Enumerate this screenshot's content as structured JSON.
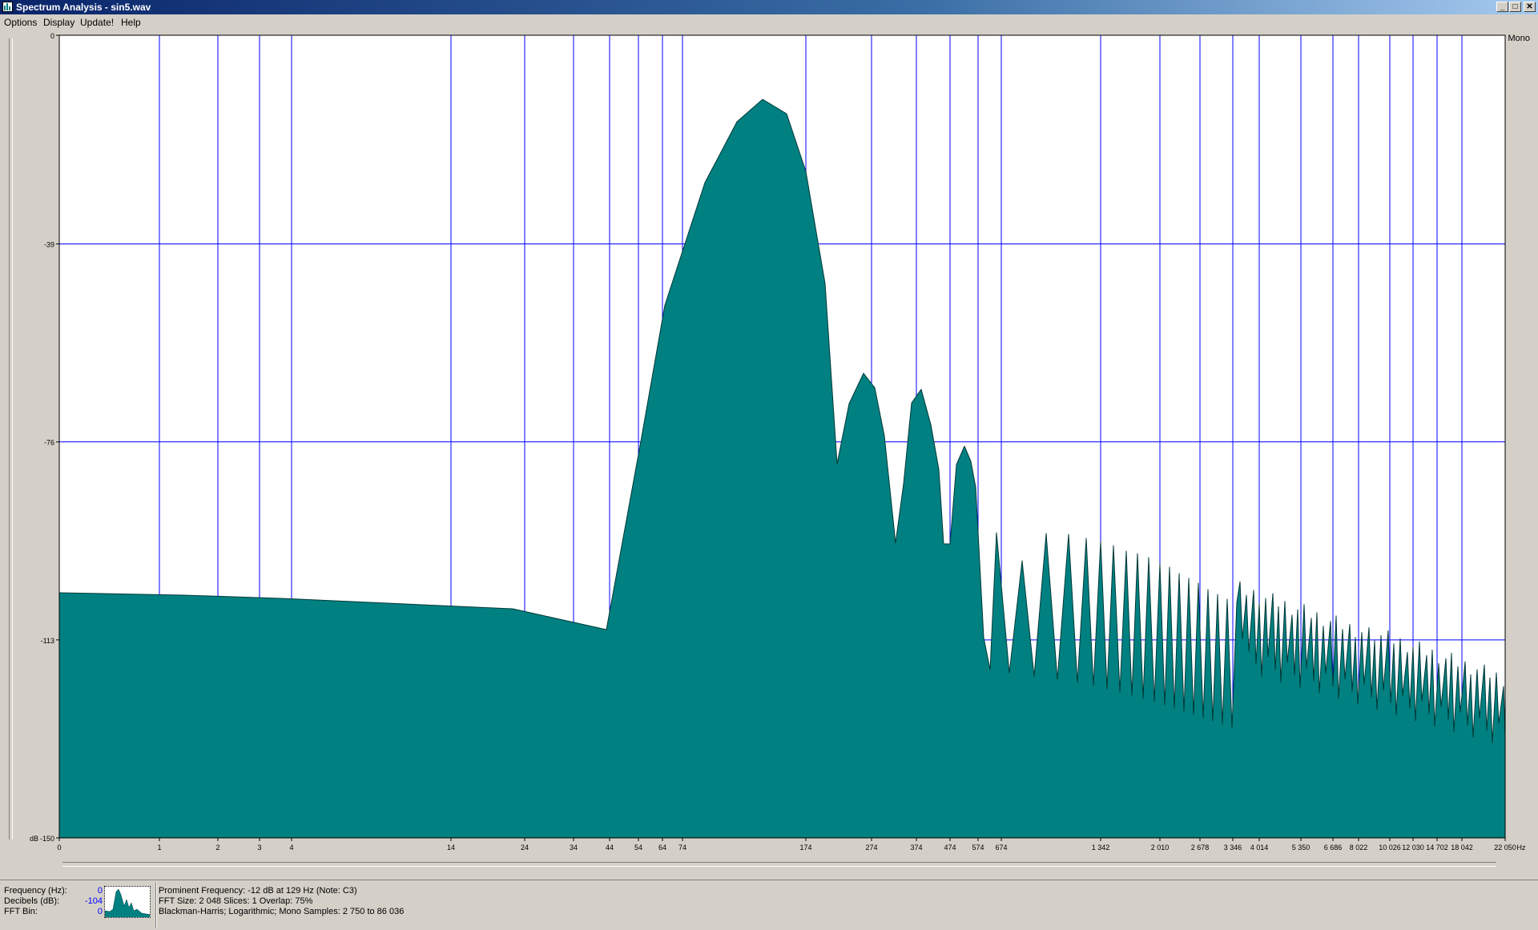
{
  "window": {
    "title": "Spectrum Analysis - sin5.wav",
    "controls": [
      "_",
      "□",
      "✕"
    ]
  },
  "menu": [
    "Options",
    "Display",
    "Update!",
    "Help"
  ],
  "channel_label": "Mono",
  "status": {
    "labels": [
      "Frequency (Hz):",
      "Decibels (dB):",
      "FFT Bin:"
    ],
    "values": [
      "0",
      "-104",
      "0"
    ],
    "info": [
      "Prominent Frequency: -12 dB at 129 Hz (Note: C3)",
      "FFT Size: 2 048  Slices: 1  Overlap: 75%",
      "Blackman-Harris; Logarithmic; Mono  Samples: 2 750 to 86 036"
    ]
  },
  "colors": {
    "fill": "#008080",
    "grid": "#0000ff",
    "plot_bg": "#ffffff",
    "axis_text": "#000000"
  },
  "chart_data": {
    "type": "area",
    "title": "",
    "xlabel": "Hz",
    "ylabel": "dB",
    "y_ticks": [
      "0",
      "-39",
      "-76",
      "-113",
      "-150"
    ],
    "ylim": [
      -150,
      0
    ],
    "x_ticks": [
      "0",
      "1",
      "2",
      "3",
      "4",
      "14",
      "24",
      "34",
      "44",
      "54",
      "64",
      "74",
      "174",
      "274",
      "374",
      "474",
      "574",
      "674",
      "1 342",
      "2 010",
      "2 678",
      "3 346",
      "4 014",
      "5 350",
      "6 686",
      "8 022",
      "10 026",
      "12 030",
      "14 702",
      "18 042",
      "22 050"
    ],
    "grid": true,
    "peaks": [
      {
        "x": 0,
        "y": -104
      },
      {
        "x": 24,
        "y": -107
      },
      {
        "x": 44,
        "y": -111
      },
      {
        "x": 129,
        "y": -12
      },
      {
        "x": 274,
        "y": -63
      },
      {
        "x": 374,
        "y": -66
      },
      {
        "x": 474,
        "y": -77
      }
    ]
  }
}
